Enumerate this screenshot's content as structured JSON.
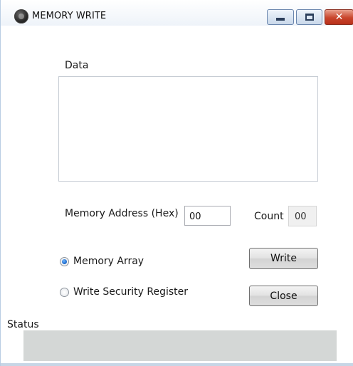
{
  "window": {
    "title": "MEMORY WRITE",
    "icon": "app-globe-icon",
    "controls": {
      "minimize": "minimize-icon",
      "maximize": "maximize-icon",
      "close": "close-icon",
      "close_glyph": "✕"
    }
  },
  "form": {
    "data_label": "Data",
    "data_value": "",
    "address_label": "Memory Address (Hex)",
    "address_value": "00",
    "count_label": "Count",
    "count_value": "00",
    "mode_options": [
      {
        "label": "Memory Array",
        "checked": true
      },
      {
        "label": "Write Security Register",
        "checked": false
      }
    ]
  },
  "buttons": {
    "write_label": "Write",
    "close_label": "Close"
  },
  "status": {
    "label": "Status",
    "text": ""
  },
  "colors": {
    "close_button": "#c9452c",
    "status_bar": "#d4d7d6",
    "radio_selected": "#1663c7"
  }
}
